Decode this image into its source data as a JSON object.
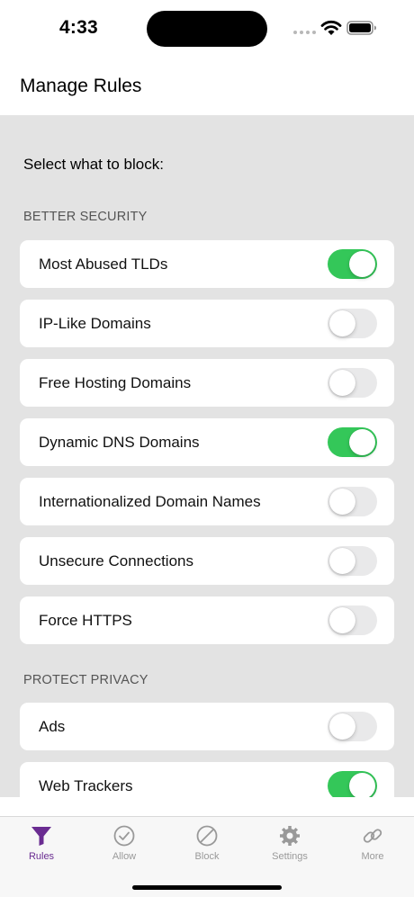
{
  "status_bar": {
    "time": "4:33"
  },
  "nav": {
    "title": "Manage Rules"
  },
  "prompt": "Select what to block:",
  "sections": [
    {
      "header": "BETTER SECURITY",
      "rules": [
        {
          "label": "Most Abused TLDs",
          "enabled": true
        },
        {
          "label": "IP-Like Domains",
          "enabled": false
        },
        {
          "label": "Free Hosting Domains",
          "enabled": false
        },
        {
          "label": "Dynamic DNS Domains",
          "enabled": true
        },
        {
          "label": "Internationalized Domain Names",
          "enabled": false
        },
        {
          "label": "Unsecure Connections",
          "enabled": false
        },
        {
          "label": "Force HTTPS",
          "enabled": false
        }
      ]
    },
    {
      "header": "PROTECT PRIVACY",
      "rules": [
        {
          "label": "Ads",
          "enabled": false
        },
        {
          "label": "Web Trackers",
          "enabled": true
        }
      ]
    }
  ],
  "tabs": [
    {
      "label": "Rules",
      "icon": "funnel-icon",
      "active": true
    },
    {
      "label": "Allow",
      "icon": "checkmark-circle-icon",
      "active": false
    },
    {
      "label": "Block",
      "icon": "prohibited-circle-icon",
      "active": false
    },
    {
      "label": "Settings",
      "icon": "gear-icon",
      "active": false
    },
    {
      "label": "More",
      "icon": "link-icon",
      "active": false
    }
  ],
  "colors": {
    "toggle_on": "#34c759",
    "toggle_off": "#e9e9ea",
    "active_tab": "#6a2c91",
    "inactive_tab": "#999999",
    "content_background": "#e3e3e3"
  }
}
